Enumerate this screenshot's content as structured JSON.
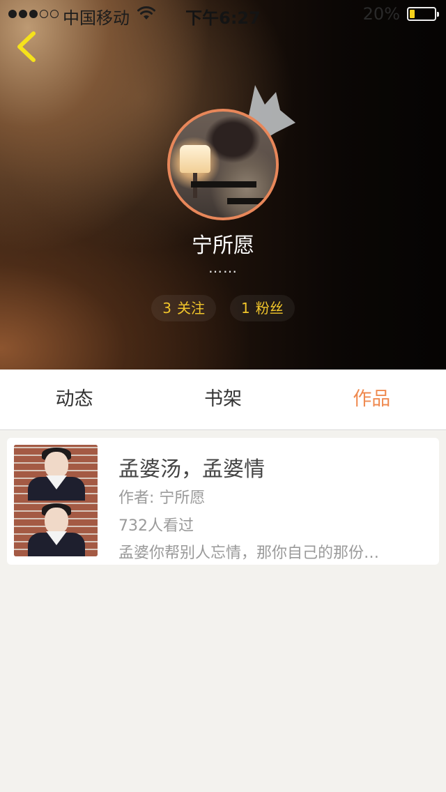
{
  "status_bar": {
    "carrier": "中国移动",
    "time": "下午6:27",
    "battery_percent": "20%",
    "battery_level": 0.2,
    "signal_bars_filled": 3,
    "signal_bars_total": 5
  },
  "profile": {
    "username": "宁所愿",
    "signature": "……",
    "following": {
      "count": "3",
      "label": "关注"
    },
    "followers": {
      "count": "1",
      "label": "粉丝"
    }
  },
  "tabs": [
    {
      "label": "动态",
      "active": false
    },
    {
      "label": "书架",
      "active": false
    },
    {
      "label": "作品",
      "active": true
    }
  ],
  "works": [
    {
      "title": "孟婆汤，孟婆情",
      "author": "作者: 宁所愿",
      "views": "732人看过",
      "summary": "孟婆你帮别人忘情，那你自己的那份…"
    }
  ],
  "colors": {
    "accent": "#ef8a50",
    "stat_text": "#f2c62b",
    "back_arrow": "#f5e21b",
    "avatar_ring": "#e8875a",
    "page_background": "#f3f2ee"
  },
  "icons": {
    "back": "chevron-left-icon",
    "badge": "crown-icon",
    "wifi": "wifi-icon",
    "battery": "battery-icon"
  }
}
